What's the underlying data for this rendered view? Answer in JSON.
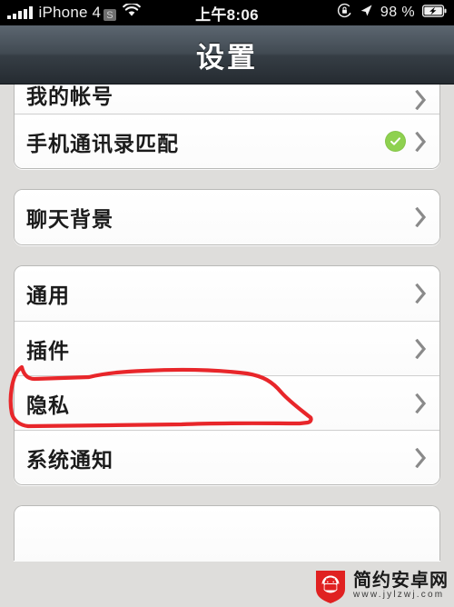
{
  "status_bar": {
    "carrier": "iPhone 4",
    "carrier_badge": "S",
    "signal_icon": "signal-bars-icon",
    "wifi_icon": "wifi-icon",
    "time": "上午8:06",
    "rotation_lock_icon": "rotation-lock-icon",
    "location_icon": "location-arrow-icon",
    "battery_percent": "98 %",
    "battery_icon": "battery-charging-icon"
  },
  "nav": {
    "title": "设置"
  },
  "sections": [
    {
      "id": "account-section",
      "clipped_top": true,
      "rows": [
        {
          "label": "我的帐号",
          "accessory": "chevron",
          "clipped": true
        },
        {
          "label": "手机通讯录匹配",
          "accessory": "check-chevron"
        }
      ]
    },
    {
      "id": "chat-section",
      "rows": [
        {
          "label": "聊天背景",
          "accessory": "chevron"
        }
      ]
    },
    {
      "id": "general-section",
      "rows": [
        {
          "label": "通用",
          "accessory": "chevron"
        },
        {
          "label": "插件",
          "accessory": "chevron",
          "annotated": true
        },
        {
          "label": "隐私",
          "accessory": "chevron"
        },
        {
          "label": "系统通知",
          "accessory": "chevron"
        }
      ]
    },
    {
      "id": "bottom-section",
      "clipped_bottom": true,
      "rows": []
    }
  ],
  "annotation": {
    "type": "hand-drawn-loop",
    "color": "#e8262a",
    "target": "插件"
  },
  "watermark": {
    "site_name": "简约安卓网",
    "url": "www.jylzwj.com",
    "logo_icon": "android-shield-logo-icon",
    "logo_color": "#e02121"
  },
  "colors": {
    "nav_bar": "#3b444c",
    "page_background": "#dedddb",
    "card_background": "#fdfdfd",
    "accent_green": "#8ed14f",
    "annotation_red": "#e8262a",
    "chevron_gray": "#8a8a8a"
  }
}
